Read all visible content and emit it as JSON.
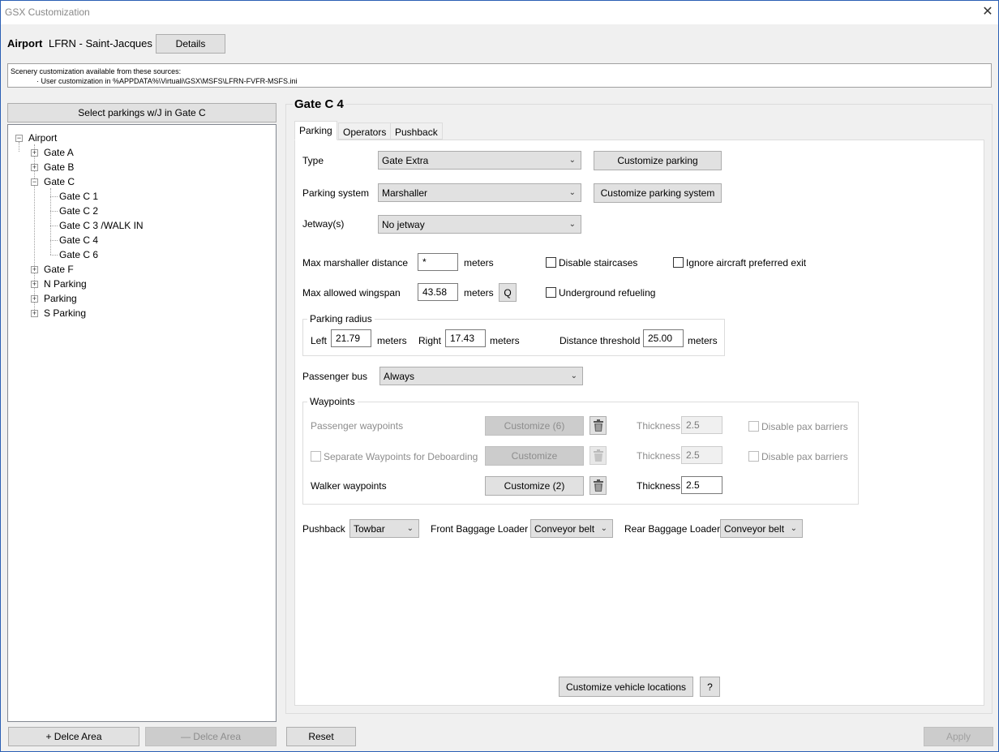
{
  "window": {
    "title": "GSX Customization",
    "close_glyph": "✕"
  },
  "airport": {
    "label": "Airport",
    "value": "LFRN - Saint-Jacques",
    "details_label": "Details"
  },
  "info": {
    "line1": "Scenery customization available from these sources:",
    "line2": "· User customization in %APPDATA%\\Virtuali\\GSX\\MSFS\\LFRN-FVFR-MSFS.ini"
  },
  "left": {
    "select_label": "Select parkings w/J in Gate C",
    "add_area_label": "+ Delce Area",
    "remove_area_label": "— Delce Area"
  },
  "tree": {
    "root": "Airport",
    "gate_a": "Gate A",
    "gate_b": "Gate B",
    "gate_c": "Gate C",
    "c1": "Gate C 1",
    "c2": "Gate C 2",
    "c3": "Gate C 3 /WALK IN",
    "c4": "Gate C 4",
    "c6": "Gate C 6",
    "gate_f": "Gate F",
    "n_parking": "N Parking",
    "parking": "Parking",
    "s_parking": "S Parking"
  },
  "panel": {
    "heading": "Gate C 4"
  },
  "tabs": {
    "parking": "Parking",
    "operators": "Operators",
    "pushback": "Pushback"
  },
  "form": {
    "type_label": "Type",
    "type_value": "Gate Extra",
    "customize_parking": "Customize parking",
    "parking_system_label": "Parking system",
    "parking_system_value": "Marshaller",
    "customize_parking_system": "Customize parking system",
    "jetways_label": "Jetway(s)",
    "jetways_value": "No jetway",
    "max_marshaller_label": "Max marshaller distance",
    "max_marshaller_value": "*",
    "meters": "meters",
    "disable_staircases": "Disable staircases",
    "ignore_exit": "Ignore aircraft preferred exit",
    "max_wingspan_label": "Max allowed wingspan",
    "max_wingspan_value": "43.58",
    "q_label": "Q",
    "underground_refueling": "Underground refueling",
    "radius_title": "Parking radius",
    "left_label": "Left",
    "left_value": "21.79",
    "right_label": "Right",
    "right_value": "17.43",
    "distance_threshold_label": "Distance threshold",
    "distance_threshold_value": "25.00",
    "passenger_bus_label": "Passenger bus",
    "passenger_bus_value": "Always",
    "waypoints_title": "Waypoints",
    "passenger_waypoints": "Passenger waypoints",
    "customize_6": "Customize (6)",
    "thickness": "Thickness",
    "thickness_pax_value": "2.5",
    "disable_pax_barriers": "Disable pax barriers",
    "separate_waypoints": "Separate Waypoints for Deboarding",
    "customize": "Customize",
    "thickness_deb_value": "2.5",
    "walker_waypoints": "Walker waypoints",
    "customize_2": "Customize (2)",
    "thickness_walker_value": "2.5",
    "pushback_label": "Pushback",
    "pushback_value": "Towbar",
    "front_loader_label": "Front Baggage Loader",
    "front_loader_value": "Conveyor belt",
    "rear_loader_label": "Rear Baggage Loader",
    "rear_loader_value": "Conveyor belt",
    "customize_vehicle": "Customize vehicle locations",
    "help_label": "?"
  },
  "footer": {
    "reset": "Reset",
    "apply": "Apply"
  },
  "icons": {
    "combo_arrow": "⌄",
    "expand": "+",
    "collapse": "−"
  }
}
